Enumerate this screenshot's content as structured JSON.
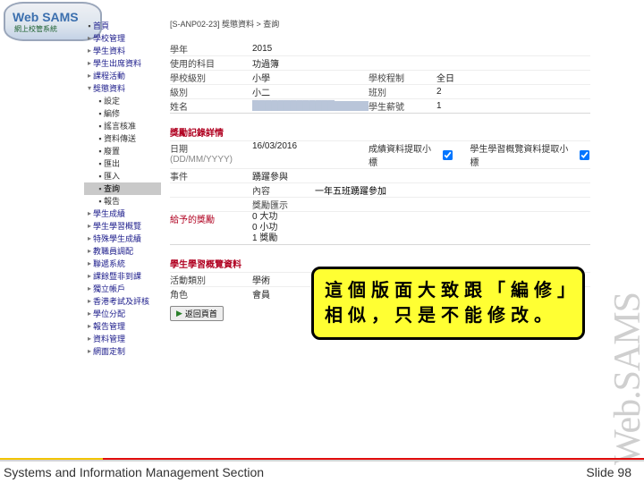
{
  "logo": {
    "title": "Web SAMS",
    "subtitle": "網上校管系統"
  },
  "sidebar": {
    "items": [
      {
        "label": "首頁",
        "kind": "dot"
      },
      {
        "label": "學校管理",
        "kind": "arrow"
      },
      {
        "label": "學生資料",
        "kind": "arrow"
      },
      {
        "label": "學生出席資料",
        "kind": "arrow"
      },
      {
        "label": "課程活動",
        "kind": "arrow"
      },
      {
        "label": "獎懲資料",
        "kind": "arrow",
        "expanded": true
      },
      {
        "label": "設定",
        "kind": "sub"
      },
      {
        "label": "編修",
        "kind": "sub"
      },
      {
        "label": "謠言核准",
        "kind": "sub"
      },
      {
        "label": "資料傳送",
        "kind": "sub"
      },
      {
        "label": "廢置",
        "kind": "sub"
      },
      {
        "label": "匯出",
        "kind": "sub"
      },
      {
        "label": "匯入",
        "kind": "sub"
      },
      {
        "label": "查詢",
        "kind": "sub",
        "selected": true
      },
      {
        "label": "報告",
        "kind": "sub"
      },
      {
        "label": "學生成績",
        "kind": "arrow"
      },
      {
        "label": "學生學習概覽",
        "kind": "arrow"
      },
      {
        "label": "特殊學生成績",
        "kind": "arrow"
      },
      {
        "label": "教職員調配",
        "kind": "arrow"
      },
      {
        "label": "聯遞系統",
        "kind": "arrow"
      },
      {
        "label": "課餘暨非到課",
        "kind": "arrow"
      },
      {
        "label": "獨立帳戶",
        "kind": "arrow"
      },
      {
        "label": "香港考試及評核",
        "kind": "arrow"
      },
      {
        "label": "學位分配",
        "kind": "arrow"
      },
      {
        "label": "報告管理",
        "kind": "arrow"
      },
      {
        "label": "資料管理",
        "kind": "arrow"
      },
      {
        "label": "網面定制",
        "kind": "arrow"
      }
    ]
  },
  "breadcrumb": "[S-ANP02-23] 獎懲資料 > 查詢",
  "form": {
    "year_label": "學年",
    "year": "2015",
    "termLbl": "使用的科目",
    "term": "功過簿",
    "levelLbl": "學校級別",
    "level": "小學",
    "schDayLbl": "學校程制",
    "schDay": "全日",
    "gradeLbl": "級別",
    "grade": "小二",
    "classLbl": "班別",
    "classVal": "2",
    "nameLbl": "姓名",
    "nameVal": "█████████████",
    "regnoLbl": "學生薪號",
    "regno": "1",
    "section1": "獎勵記錄詳情",
    "dateLbl": "日期",
    "dateSub": "(DD/MM/YYYY)",
    "date": "16/03/2016",
    "chk1": "成績資料提取小標",
    "chk2": "學生學習概覽資料提取小標",
    "eventLbl": "事件",
    "event": "踴躍參與",
    "contentLbl": "內容",
    "content": "一年五班踴躍參加",
    "rewardsLbl": "獎勵匯示",
    "section2": "給予的獎勵",
    "rewards": [
      "0 大功",
      "0 小功",
      "1 獎勵"
    ],
    "section3": "學生學習概覽資料",
    "actTypeLbl": "活動類別",
    "actType": "學術",
    "roleLbl": "角色",
    "role": "會員",
    "backBtn": "▶返回頁首"
  },
  "callout": "這個版面大致跟「編修」相似，只是不能修改。",
  "watermark": "Web.SAMS",
  "footer": {
    "left": "Systems and Information Management Section",
    "right": "Slide 98"
  }
}
